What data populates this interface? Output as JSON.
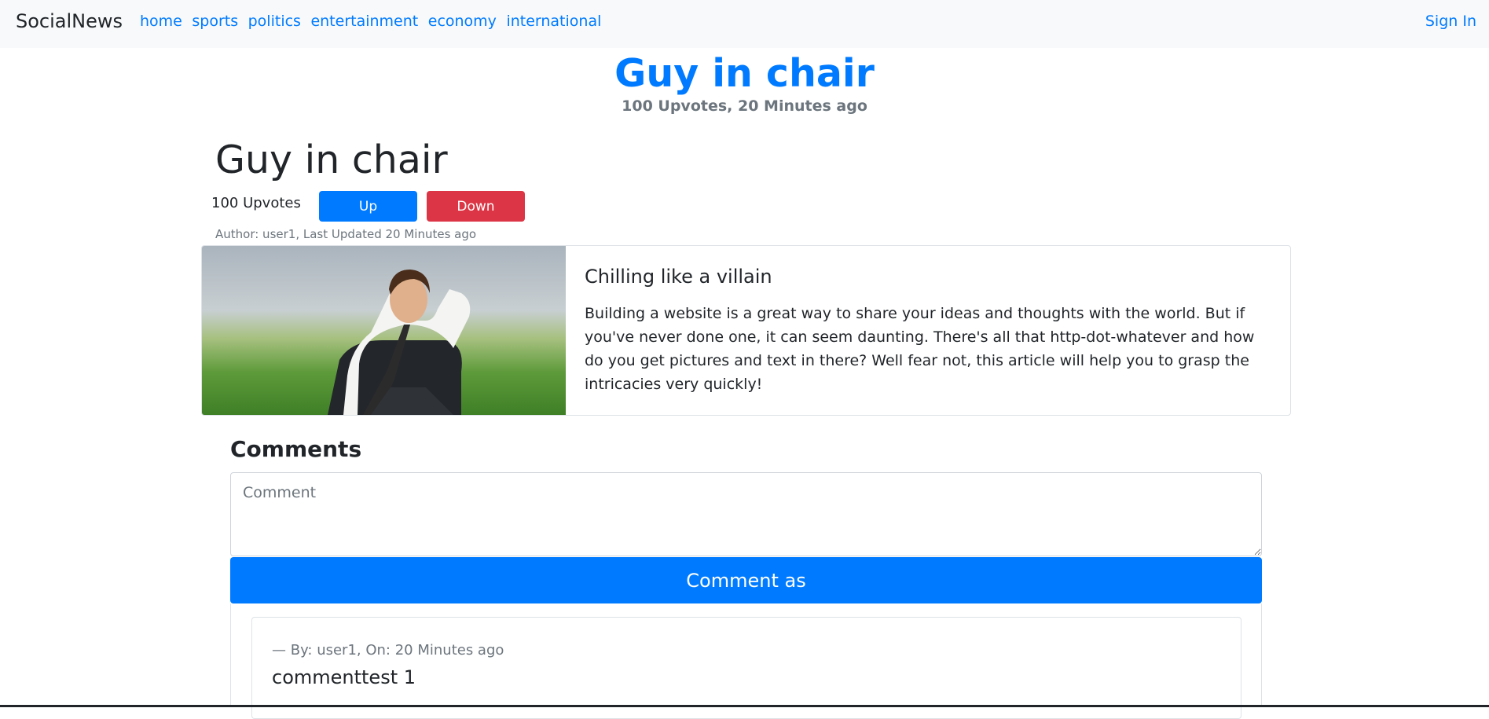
{
  "navbar": {
    "brand": "SocialNews",
    "links": [
      "home",
      "sports",
      "politics",
      "entertainment",
      "economy",
      "international"
    ],
    "sign_in": "Sign In"
  },
  "hero": {
    "title": "Guy in chair",
    "meta": "100 Upvotes, 20 Minutes ago"
  },
  "article": {
    "title": "Guy in chair",
    "upvotes": "100 Upvotes",
    "up_label": "Up",
    "down_label": "Down",
    "author_line": "Author: user1, Last Updated 20 Minutes ago",
    "card_title": "Chilling like a villain",
    "card_text": "Building a website is a great way to share your ideas and thoughts with the world. But if you've never done one, it can seem daunting. There's all that http-dot-whatever and how do you get pictures and text in there? Well fear not, this article will help you to grasp the intricacies very quickly!"
  },
  "comments": {
    "heading": "Comments",
    "input_placeholder": "Comment",
    "submit_label": "Comment as",
    "items": [
      {
        "meta": "— By: user1, On: 20 Minutes ago",
        "text": "commenttest 1"
      }
    ]
  }
}
